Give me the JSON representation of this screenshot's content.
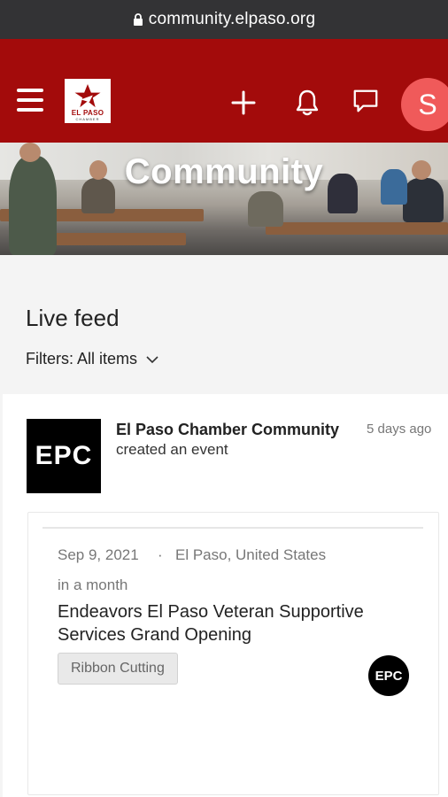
{
  "browser": {
    "url": "community.elpaso.org"
  },
  "header": {
    "logo_text": "EL PASO",
    "logo_subtext": "CHAMBER",
    "avatar_initial": "S",
    "brand_color": "#a30b0b",
    "avatar_color": "#f05a5a"
  },
  "hero": {
    "title": "Community"
  },
  "feed": {
    "title": "Live feed",
    "filter_label": "Filters: All items"
  },
  "post": {
    "author_logo_text": "EPC",
    "author": "El Paso Chamber Community",
    "action": "created an event",
    "time": "5 days ago",
    "event": {
      "date": "Sep 9, 2021",
      "separator": "·",
      "location": "El Paso, United States",
      "relative": "in a month",
      "title": "Endeavors El Paso Veteran Supportive Services Grand Opening",
      "tag": "Ribbon Cutting",
      "organizer_logo_text": "EPC"
    }
  }
}
